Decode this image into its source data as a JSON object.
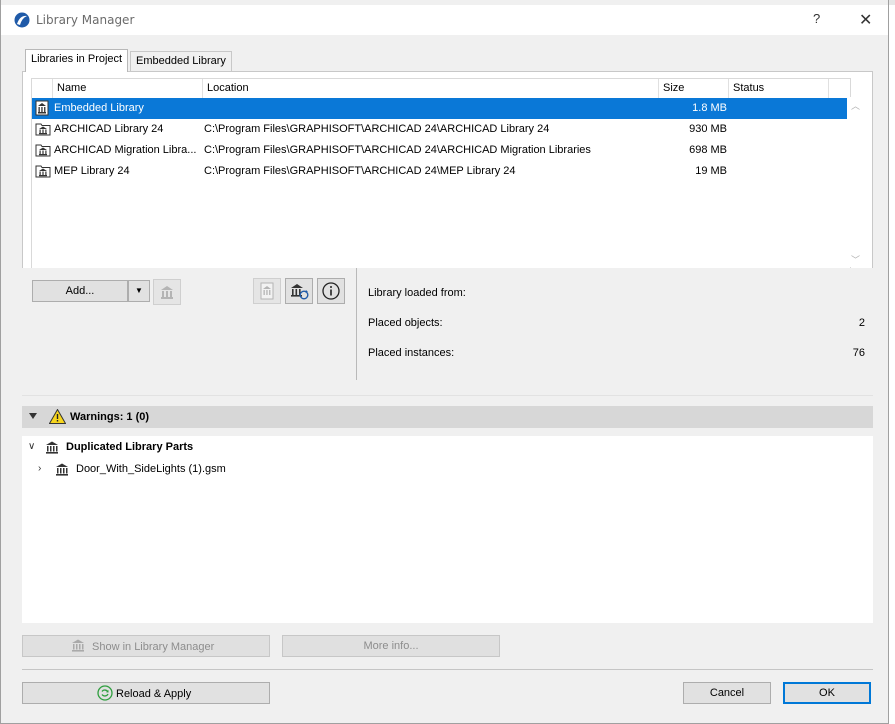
{
  "window": {
    "title": "Library Manager",
    "help": "?",
    "close": "✕"
  },
  "tabs": [
    {
      "label": "Libraries in Project",
      "active": true
    },
    {
      "label": "Embedded Library",
      "active": false
    }
  ],
  "table": {
    "columns": [
      "Name",
      "Location",
      "Size",
      "Status"
    ],
    "rows": [
      {
        "name": "Embedded Library",
        "location": "",
        "size": "1.8 MB",
        "status": "",
        "selected": true
      },
      {
        "name": "ARCHICAD Library 24",
        "location": "C:\\Program Files\\GRAPHISOFT\\ARCHICAD 24\\ARCHICAD Library 24",
        "size": "930 MB",
        "status": ""
      },
      {
        "name": "ARCHICAD Migration Libra...",
        "location": "C:\\Program Files\\GRAPHISOFT\\ARCHICAD 24\\ARCHICAD Migration Libraries",
        "size": "698 MB",
        "status": ""
      },
      {
        "name": "MEP Library 24",
        "location": "C:\\Program Files\\GRAPHISOFT\\ARCHICAD 24\\MEP Library 24",
        "size": "19 MB",
        "status": ""
      }
    ]
  },
  "actions": {
    "add_label": "Add...",
    "dropdown_glyph": "▼"
  },
  "info": {
    "loaded_from_label": "Library loaded from:",
    "loaded_from_value": "",
    "placed_objects_label": "Placed objects:",
    "placed_objects_value": "2",
    "placed_instances_label": "Placed instances:",
    "placed_instances_value": "76"
  },
  "warnings": {
    "header": "Warnings: 1 (0)",
    "groups": [
      {
        "label": "Duplicated Library Parts",
        "expanded": true,
        "children": [
          "Door_With_SideLights (1).gsm"
        ]
      }
    ]
  },
  "bottom": {
    "show_in_library_manager": "Show in Library Manager",
    "more_info": "More info...",
    "reload_apply": "Reload & Apply",
    "cancel": "Cancel",
    "ok": "OK"
  },
  "colors": {
    "selection": "#0a78d7",
    "ok_border": "#0078d7",
    "warning_yellow": "#f7d51d"
  }
}
